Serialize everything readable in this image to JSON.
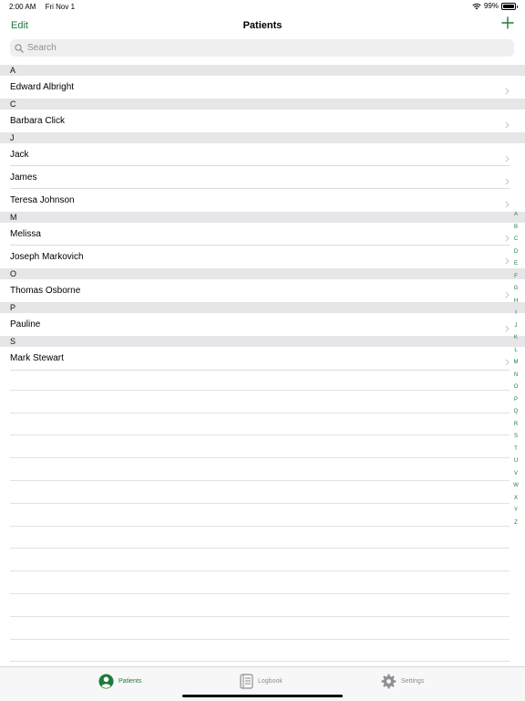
{
  "status_bar": {
    "time": "2:00 AM",
    "date": "Fri Nov 1",
    "battery": "99%",
    "battery_level": 0.99
  },
  "nav": {
    "edit_label": "Edit",
    "title": "Patients"
  },
  "search": {
    "placeholder": "Search"
  },
  "sections": [
    {
      "letter": "A",
      "rows": [
        "Edward Albright"
      ]
    },
    {
      "letter": "C",
      "rows": [
        "Barbara Click"
      ]
    },
    {
      "letter": "J",
      "rows": [
        "Jack",
        "James",
        "Teresa Johnson"
      ]
    },
    {
      "letter": "M",
      "rows": [
        "Melissa",
        "Joseph Markovich"
      ]
    },
    {
      "letter": "O",
      "rows": [
        "Thomas Osborne"
      ]
    },
    {
      "letter": "P",
      "rows": [
        "Pauline"
      ]
    },
    {
      "letter": "S",
      "rows": [
        "Mark Stewart"
      ]
    }
  ],
  "index_letters": [
    "A",
    "B",
    "C",
    "D",
    "E",
    "F",
    "G",
    "H",
    "I",
    "J",
    "K",
    "L",
    "M",
    "N",
    "O",
    "P",
    "Q",
    "R",
    "S",
    "T",
    "U",
    "V",
    "W",
    "X",
    "Y",
    "Z"
  ],
  "tabs": [
    {
      "label": "Patients",
      "icon": "person-circle-icon",
      "active": true
    },
    {
      "label": "Logbook",
      "icon": "notebook-icon",
      "active": false
    },
    {
      "label": "Settings",
      "icon": "gear-icon",
      "active": false
    }
  ],
  "colors": {
    "accent": "#1e7a3c",
    "inactive": "#8e8e93",
    "section_bg": "#e6e6e8"
  }
}
